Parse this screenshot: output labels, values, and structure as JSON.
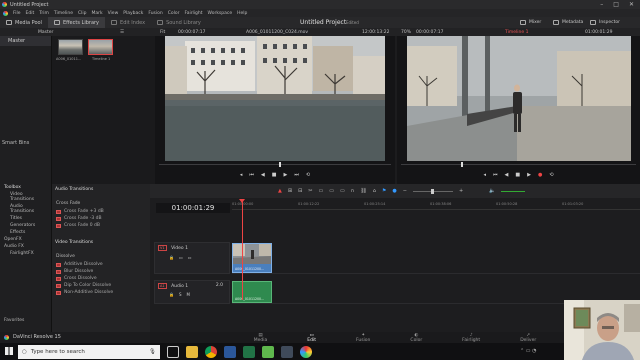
{
  "window": {
    "title": "Untitled Project"
  },
  "menu": [
    "DaVinci Resolve",
    "File",
    "Edit",
    "Trim",
    "Timeline",
    "Clip",
    "Mark",
    "View",
    "Playback",
    "Fusion",
    "Color",
    "Fairlight",
    "Workspace",
    "Help"
  ],
  "toolbar": {
    "media_pool": "Media Pool",
    "effects_library": "Effects Library",
    "edit_index": "Edit Index",
    "sound_library": "Sound Library",
    "project_title": "Untitled Project",
    "edited": "Edited",
    "mixer": "Mixer",
    "metadata": "Metadata",
    "inspector": "Inspector"
  },
  "subbar": {
    "bin": "Master",
    "fit": "Fit",
    "source_tc": "00:00:07:17",
    "clip_name": "A006_01011200_C024.mov",
    "source_duration": "12:00:13:22",
    "zoom": "70%",
    "program_tc": "00:00:07:17",
    "timeline_name": "Timeline 1",
    "program_pos": "01:00:01:29"
  },
  "media_pool": {
    "bins": [
      "Master"
    ],
    "smart_bins": "Smart Bins",
    "clips": [
      {
        "label": "A006_01011..."
      },
      {
        "label": "Timeline 1"
      }
    ]
  },
  "effects": {
    "tree": [
      "Toolbox",
      "Video Transitions",
      "Audio Transitions",
      "Titles",
      "Generators",
      "Effects",
      "OpenFX",
      "Audio FX",
      "FairlightFX"
    ],
    "favorites": "Favorites",
    "audio_transitions_title": "Audio Transitions",
    "crossfade_title": "Cross Fade",
    "audio_items": [
      "Cross Fade +3 dB",
      "Cross Fade -3 dB",
      "Cross Fade 0 dB"
    ],
    "video_transitions_title": "Video Transitions",
    "dissolve_title": "Dissolve",
    "video_items": [
      "Additive Dissolve",
      "Blur Dissolve",
      "Cross Dissolve",
      "Dip To Color Dissolve",
      "Non-Additive Dissolve"
    ]
  },
  "timeline": {
    "timecode": "01:00:01:29",
    "ruler": [
      "01:00:00:00",
      "01:00:12:22",
      "01:00:25:14",
      "01:00:38:06",
      "01:00:50:28",
      "01:01:03:20",
      "01:01:16:12"
    ],
    "video_track": {
      "badge": "V1",
      "name": "Video 1",
      "clip": "A006_01011200..."
    },
    "audio_track": {
      "badge": "A1",
      "name": "Audio 1",
      "level": "2.0",
      "clip": "A006_01011200..."
    }
  },
  "pages": [
    "Media",
    "Edit",
    "Fusion",
    "Color",
    "Fairlight",
    "Deliver"
  ],
  "active_page": "Edit",
  "app_name": "DaVinci Resolve 15",
  "taskbar": {
    "search_placeholder": "Type here to search"
  },
  "colors": {
    "accent_red": "#e44444",
    "clip_blue": "#4a7fbd",
    "audio_green": "#2f8a4f"
  }
}
